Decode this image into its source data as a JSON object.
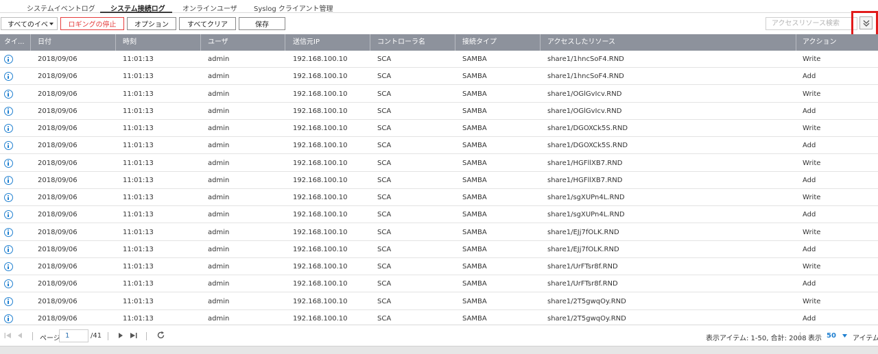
{
  "tabs": [
    "システムイベントログ",
    "システム接続ログ",
    "オンラインユーザ",
    "Syslog クライアント管理"
  ],
  "toolbar": {
    "filter_value": "すべてのイベ",
    "stop_logging": "ロギングの停止",
    "options": "オプション",
    "clear_all": "すべてクリア",
    "save": "保存",
    "search_placeholder": "アクセスリソース検索"
  },
  "columns": [
    "タイ...",
    "日付",
    "時刻",
    "ユーザ",
    "送信元IP",
    "コントローラ名",
    "接続タイプ",
    "アクセスしたリソース",
    "アクション"
  ],
  "rows": [
    {
      "date": "2018/09/06",
      "time": "11:01:13",
      "user": "admin",
      "ip": "192.168.100.10",
      "controller": "SCA",
      "conn": "SAMBA",
      "resource": "share1/1hncSoF4.RND",
      "action": "Write"
    },
    {
      "date": "2018/09/06",
      "time": "11:01:13",
      "user": "admin",
      "ip": "192.168.100.10",
      "controller": "SCA",
      "conn": "SAMBA",
      "resource": "share1/1hncSoF4.RND",
      "action": "Add"
    },
    {
      "date": "2018/09/06",
      "time": "11:01:13",
      "user": "admin",
      "ip": "192.168.100.10",
      "controller": "SCA",
      "conn": "SAMBA",
      "resource": "share1/OGlGvIcv.RND",
      "action": "Write"
    },
    {
      "date": "2018/09/06",
      "time": "11:01:13",
      "user": "admin",
      "ip": "192.168.100.10",
      "controller": "SCA",
      "conn": "SAMBA",
      "resource": "share1/OGlGvIcv.RND",
      "action": "Add"
    },
    {
      "date": "2018/09/06",
      "time": "11:01:13",
      "user": "admin",
      "ip": "192.168.100.10",
      "controller": "SCA",
      "conn": "SAMBA",
      "resource": "share1/DGOXCk5S.RND",
      "action": "Write"
    },
    {
      "date": "2018/09/06",
      "time": "11:01:13",
      "user": "admin",
      "ip": "192.168.100.10",
      "controller": "SCA",
      "conn": "SAMBA",
      "resource": "share1/DGOXCk5S.RND",
      "action": "Add"
    },
    {
      "date": "2018/09/06",
      "time": "11:01:13",
      "user": "admin",
      "ip": "192.168.100.10",
      "controller": "SCA",
      "conn": "SAMBA",
      "resource": "share1/HGFllXB7.RND",
      "action": "Write"
    },
    {
      "date": "2018/09/06",
      "time": "11:01:13",
      "user": "admin",
      "ip": "192.168.100.10",
      "controller": "SCA",
      "conn": "SAMBA",
      "resource": "share1/HGFllXB7.RND",
      "action": "Add"
    },
    {
      "date": "2018/09/06",
      "time": "11:01:13",
      "user": "admin",
      "ip": "192.168.100.10",
      "controller": "SCA",
      "conn": "SAMBA",
      "resource": "share1/sgXUPn4L.RND",
      "action": "Write"
    },
    {
      "date": "2018/09/06",
      "time": "11:01:13",
      "user": "admin",
      "ip": "192.168.100.10",
      "controller": "SCA",
      "conn": "SAMBA",
      "resource": "share1/sgXUPn4L.RND",
      "action": "Add"
    },
    {
      "date": "2018/09/06",
      "time": "11:01:13",
      "user": "admin",
      "ip": "192.168.100.10",
      "controller": "SCA",
      "conn": "SAMBA",
      "resource": "share1/EJj7fOLK.RND",
      "action": "Write"
    },
    {
      "date": "2018/09/06",
      "time": "11:01:13",
      "user": "admin",
      "ip": "192.168.100.10",
      "controller": "SCA",
      "conn": "SAMBA",
      "resource": "share1/EJj7fOLK.RND",
      "action": "Add"
    },
    {
      "date": "2018/09/06",
      "time": "11:01:13",
      "user": "admin",
      "ip": "192.168.100.10",
      "controller": "SCA",
      "conn": "SAMBA",
      "resource": "share1/UrFTsr8f.RND",
      "action": "Write"
    },
    {
      "date": "2018/09/06",
      "time": "11:01:13",
      "user": "admin",
      "ip": "192.168.100.10",
      "controller": "SCA",
      "conn": "SAMBA",
      "resource": "share1/UrFTsr8f.RND",
      "action": "Add"
    },
    {
      "date": "2018/09/06",
      "time": "11:01:13",
      "user": "admin",
      "ip": "192.168.100.10",
      "controller": "SCA",
      "conn": "SAMBA",
      "resource": "share1/2T5gwqOy.RND",
      "action": "Write"
    },
    {
      "date": "2018/09/06",
      "time": "11:01:13",
      "user": "admin",
      "ip": "192.168.100.10",
      "controller": "SCA",
      "conn": "SAMBA",
      "resource": "share1/2T5gwqOy.RND",
      "action": "Add"
    }
  ],
  "footer": {
    "page_label": "ページ",
    "page_value": "1",
    "page_total": "/41",
    "display_items": "表示アイテム: 1-50, 合計: 2008",
    "show_label": "表示",
    "per_page": "50",
    "items_label": "アイテム"
  },
  "colors": {
    "header_bg": "#8d929c",
    "accent": "#1e7fd0",
    "highlight": "#e11a1a",
    "stop_red": "#e53a3a"
  }
}
